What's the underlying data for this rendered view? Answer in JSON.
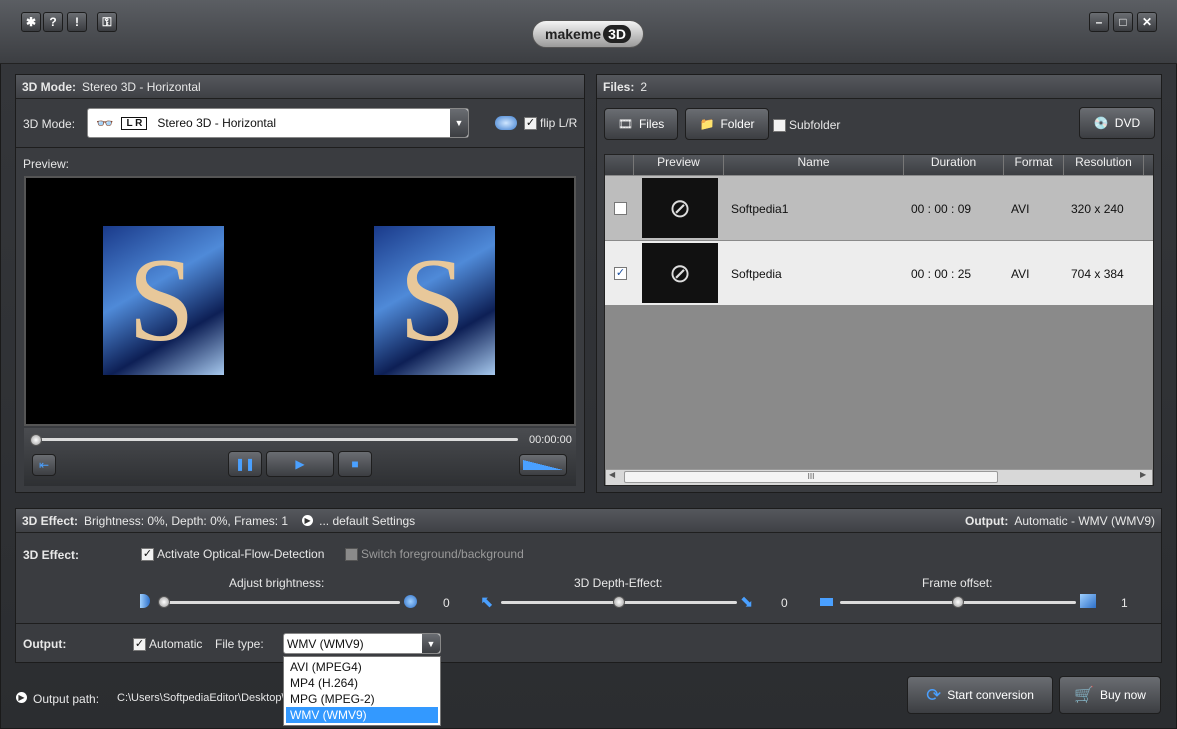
{
  "app": {
    "logo_text": "makeme",
    "logo_badge": "3D"
  },
  "toolbar_icons": [
    "gear-icon",
    "help-icon",
    "info-icon",
    "lock-icon"
  ],
  "window_buttons": {
    "minimize": "–",
    "maximize": "□",
    "close": "✕"
  },
  "mode_panel": {
    "title_label": "3D Mode:",
    "title_value": "Stereo 3D - Horizontal",
    "mode_label": "3D Mode:",
    "mode_value": "Stereo 3D - Horizontal",
    "mode_badge": "L R",
    "flip_label": "flip L/R",
    "flip_checked": true,
    "preview_label": "Preview:",
    "time": "00:00:00"
  },
  "files_panel": {
    "title_label": "Files:",
    "count": "2",
    "files_button": "Files",
    "folder_button": "Folder",
    "subfolder_label": "Subfolder",
    "dvd_button": "DVD",
    "columns": [
      "Preview",
      "Name",
      "Duration",
      "Format",
      "Resolution"
    ],
    "rows": [
      {
        "name": "Softpedia1",
        "duration": "00 : 00 : 09",
        "format": "AVI",
        "resolution": "320 x 240",
        "checked": false
      },
      {
        "name": "Softpedia",
        "duration": "00 : 00 : 25",
        "format": "AVI",
        "resolution": "704 x 384",
        "checked": true
      }
    ],
    "scroll_grip": "III"
  },
  "effect_panel": {
    "title_label": "3D Effect:",
    "title_value": "Brightness: 0%, Depth: 0%, Frames: 1",
    "default_link": "... default Settings",
    "output_label": "Output:",
    "output_value": "Automatic - WMV (WMV9)",
    "effect_label": "3D Effect:",
    "optical_flow_label": "Activate Optical-Flow-Detection",
    "optical_flow_checked": true,
    "switch_label": "Switch foreground/background",
    "brightness_label": "Adjust brightness:",
    "brightness_value": "0",
    "depth_label": "3D Depth-Effect:",
    "depth_value": "0",
    "frame_label": "Frame offset:",
    "frame_value": "1",
    "output_row_label": "Output:",
    "automatic_label": "Automatic",
    "automatic_checked": true,
    "filetype_label": "File type:",
    "filetype_value": "WMV (WMV9)",
    "filetype_options": [
      "AVI (MPEG4)",
      "MP4 (H.264)",
      "MPG (MPEG-2)",
      "WMV (WMV9)"
    ],
    "filetype_selected_index": 3
  },
  "footer": {
    "output_path_label": "Output path:",
    "output_path_value": "C:\\Users\\SoftpediaEditor\\Desktop\\",
    "start_button": "Start conversion",
    "buy_button": "Buy now"
  },
  "colors": {
    "selection": "#3399ff",
    "panel": "#3a3c40",
    "row_selected": "#ededed"
  }
}
